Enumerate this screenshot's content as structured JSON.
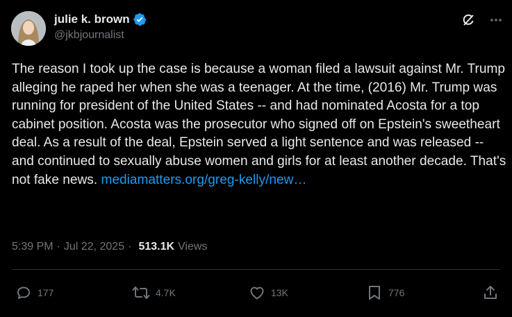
{
  "author": {
    "name": "julie k. brown",
    "handle": "@jkbjournalist",
    "verified": true
  },
  "post": {
    "text": "The reason I took up the case is because a woman filed a lawsuit against Mr. Trump alleging he raped her when she was a teenager. At the time, (2016) Mr. Trump was running for president of the United States -- and had nominated Acosta for a top cabinet position. Acosta was the prosecutor who signed off on Epstein's sweetheart deal. As a result of the deal, Epstein served a light sentence and was released -- and continued to sexually abuse women and girls for at least another decade. That's not fake news. ",
    "link_text": "mediamatters.org/greg-kelly/new…"
  },
  "meta": {
    "time": "5:39 PM",
    "date": "Jul 22, 2025",
    "views_count": "513.1K",
    "views_label": "Views",
    "separator": "·"
  },
  "actions": {
    "replies": "177",
    "reposts": "4.7K",
    "likes": "13K",
    "bookmarks": "776"
  },
  "colors": {
    "background": "#000000",
    "text": "#e7e9ea",
    "secondary": "#71767b",
    "link": "#1d9bf0",
    "divider": "#2f3336"
  },
  "icons": [
    "grok-icon",
    "more-icon",
    "verified-badge-icon",
    "reply-icon",
    "repost-icon",
    "like-icon",
    "bookmark-icon",
    "share-icon"
  ]
}
